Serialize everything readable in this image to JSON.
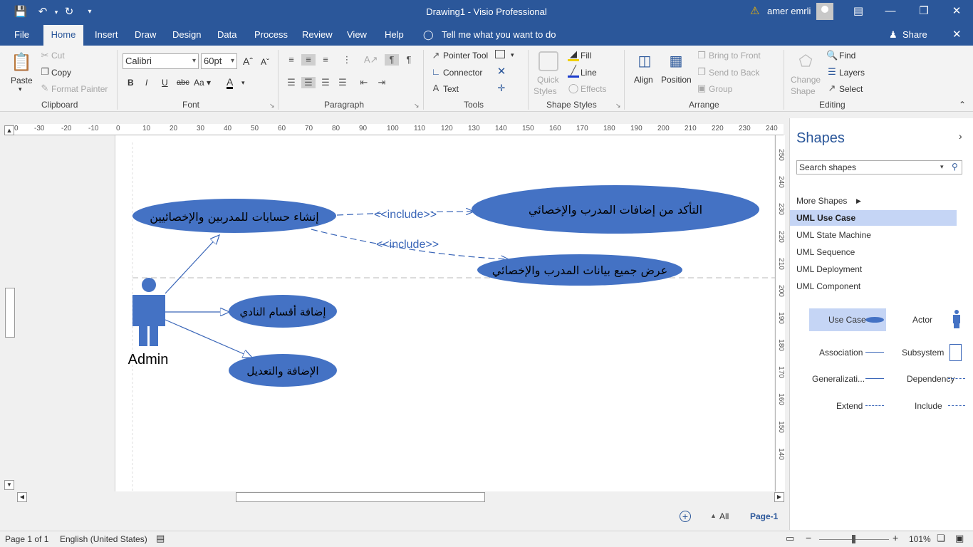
{
  "titlebar": {
    "doc_title": "Drawing1  -  Visio Professional",
    "user_name": "amer emrli"
  },
  "tabs": [
    "File",
    "Home",
    "Insert",
    "Draw",
    "Design",
    "Data",
    "Process",
    "Review",
    "View",
    "Help"
  ],
  "tell_me": "Tell me what you want to do",
  "share_label": "Share",
  "ribbon": {
    "clipboard": {
      "label": "Clipboard",
      "paste": "Paste",
      "cut": "Cut",
      "copy": "Copy",
      "format_painter": "Format Painter"
    },
    "font": {
      "label": "Font",
      "family": "Calibri",
      "size": "60pt"
    },
    "paragraph": {
      "label": "Paragraph"
    },
    "tools": {
      "label": "Tools",
      "pointer": "Pointer Tool",
      "connector": "Connector",
      "text": "Text"
    },
    "shape_styles": {
      "label": "Shape Styles",
      "quick_styles_1": "Quick",
      "quick_styles_2": "Styles",
      "fill": "Fill",
      "line": "Line",
      "effects": "Effects"
    },
    "arrange": {
      "label": "Arrange",
      "align": "Align",
      "position": "Position",
      "bring_front": "Bring to Front",
      "send_back": "Send to Back",
      "group": "Group"
    },
    "editing": {
      "label": "Editing",
      "change_shape_1": "Change",
      "change_shape_2": "Shape",
      "find": "Find",
      "layers": "Layers",
      "select": "Select"
    }
  },
  "ruler": {
    "h_ticks": [
      "0",
      "-30",
      "-20",
      "-10",
      "0",
      "10",
      "20",
      "30",
      "40",
      "50",
      "60",
      "70",
      "80",
      "90",
      "100",
      "110",
      "120",
      "130",
      "140",
      "150",
      "160",
      "170",
      "180",
      "190",
      "200",
      "210",
      "220",
      "230",
      "240"
    ],
    "v_ticks": [
      "250",
      "240",
      "230",
      "220",
      "210",
      "200",
      "190",
      "180",
      "170",
      "160",
      "150",
      "140"
    ]
  },
  "diagram": {
    "actor_label": "Admin",
    "use_cases": {
      "create_accounts": "إنشاء حسابات للمدربين والإخصائيين",
      "verify_additions": "التأكد من إضافات المدرب والإخصائي",
      "view_data": "عرض جميع بيانات المدرب والإخصائي",
      "add_sections": "إضافة أقسام النادي",
      "add_edit": "الإضافة والتعديل"
    },
    "include_1": "<<include>>",
    "include_2": "<<include>>",
    "shape_fill": "#4472c4",
    "line_color": "#3a66b8"
  },
  "shapes_pane": {
    "title": "Shapes",
    "search_placeholder": "Search shapes",
    "more_shapes": "More Shapes",
    "stencils": [
      "UML Use Case",
      "UML State Machine",
      "UML Sequence",
      "UML Deployment",
      "UML Component"
    ],
    "masters": {
      "use_case": "Use Case",
      "actor": "Actor",
      "association": "Association",
      "subsystem": "Subsystem",
      "generalization": "Generalizati...",
      "dependency": "Dependency",
      "extend": "Extend",
      "include": "Include"
    }
  },
  "page_tabs": {
    "all": "All",
    "page1": "Page-1"
  },
  "status": {
    "page": "Page 1 of 1",
    "language": "English (United States)",
    "zoom": "101%"
  }
}
